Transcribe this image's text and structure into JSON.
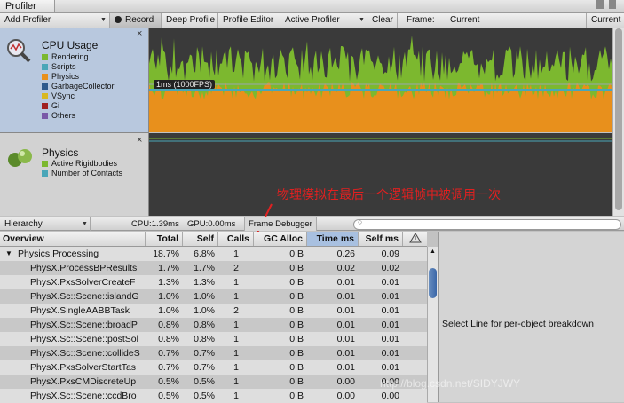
{
  "window": {
    "tab_title": "Profiler"
  },
  "toolbar": {
    "add_profiler": "Add Profiler",
    "record": "Record",
    "deep_profile": "Deep Profile",
    "profile_editor": "Profile Editor",
    "active_profiler": "Active Profiler",
    "clear": "Clear",
    "frame_label": "Frame:",
    "frame_value": "Current",
    "current_button": "Current"
  },
  "cpu_panel": {
    "title": "CPU Usage",
    "legend": [
      {
        "label": "Rendering",
        "color": "#7cb82f"
      },
      {
        "label": "Scripts",
        "color": "#4aa6b8"
      },
      {
        "label": "Physics",
        "color": "#e8901c"
      },
      {
        "label": "GarbageCollector",
        "color": "#2f5a8c"
      },
      {
        "label": "VSync",
        "color": "#d8b820"
      },
      {
        "label": "Gi",
        "color": "#a02020"
      },
      {
        "label": "Others",
        "color": "#7a5aa8"
      }
    ],
    "graph_label": "1ms (1000FPS)"
  },
  "physics_panel": {
    "title": "Physics",
    "legend": [
      {
        "label": "Active Rigidbodies",
        "color": "#7cb82f"
      },
      {
        "label": "Number of Contacts",
        "color": "#4aa6b8"
      }
    ]
  },
  "bottom_bar": {
    "hierarchy": "Hierarchy",
    "cpu": "CPU:1.39ms",
    "gpu": "GPU:0.00ms",
    "frame_debugger": "Frame Debugger"
  },
  "table": {
    "columns": [
      "Overview",
      "Total",
      "Self",
      "Calls",
      "GC Alloc",
      "Time ms",
      "Self ms"
    ],
    "rows": [
      [
        "Physics.Processing",
        "18.7%",
        "6.8%",
        "1",
        "0 B",
        "0.26",
        "0.09"
      ],
      [
        "PhysX.ProcessBPResults",
        "1.7%",
        "1.7%",
        "2",
        "0 B",
        "0.02",
        "0.02"
      ],
      [
        "PhysX.PxsSolverCreateF",
        "1.3%",
        "1.3%",
        "1",
        "0 B",
        "0.01",
        "0.01"
      ],
      [
        "PhysX.Sc::Scene::islandG",
        "1.0%",
        "1.0%",
        "1",
        "0 B",
        "0.01",
        "0.01"
      ],
      [
        "PhysX.SingleAABBTask",
        "1.0%",
        "1.0%",
        "2",
        "0 B",
        "0.01",
        "0.01"
      ],
      [
        "PhysX.Sc::Scene::broadP",
        "0.8%",
        "0.8%",
        "1",
        "0 B",
        "0.01",
        "0.01"
      ],
      [
        "PhysX.Sc::Scene::postSol",
        "0.8%",
        "0.8%",
        "1",
        "0 B",
        "0.01",
        "0.01"
      ],
      [
        "PhysX.Sc::Scene::collideS",
        "0.7%",
        "0.7%",
        "1",
        "0 B",
        "0.01",
        "0.01"
      ],
      [
        "PhysX.PxsSolverStartTas",
        "0.7%",
        "0.7%",
        "1",
        "0 B",
        "0.01",
        "0.01"
      ],
      [
        "PhysX.PxsCMDiscreteUp",
        "0.5%",
        "0.5%",
        "1",
        "0 B",
        "0.00",
        "0.00"
      ],
      [
        "PhysX.Sc::Scene::ccdBro",
        "0.5%",
        "0.5%",
        "1",
        "0 B",
        "0.00",
        "0.00"
      ]
    ]
  },
  "detail_panel": {
    "text": "Select Line for per-object breakdown"
  },
  "annotation": {
    "text": "物理模拟在最后一个逻辑帧中被调用一次"
  },
  "watermark": "http://blog.csdn.net/SIDYJWY"
}
